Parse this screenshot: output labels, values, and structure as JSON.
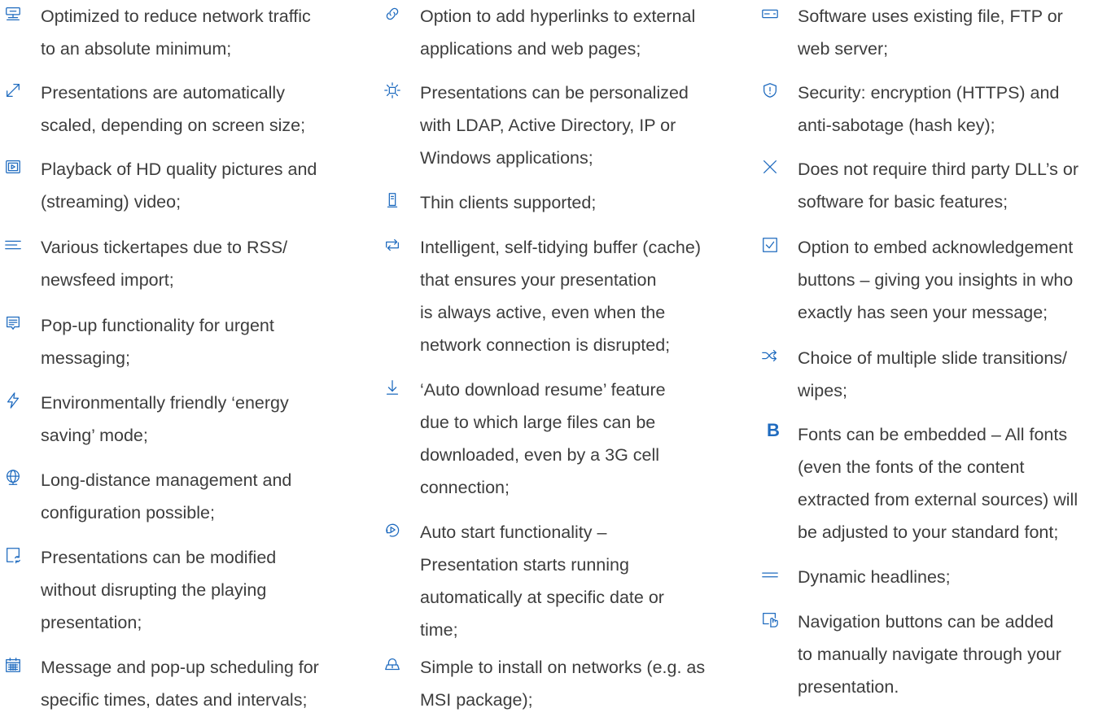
{
  "columns": [
    {
      "items": [
        {
          "icon": "network-monitor-icon",
          "lines": [
            "Optimized to reduce network traffic",
            "to an absolute minimum;"
          ]
        },
        {
          "icon": "expand-arrow-icon",
          "lines": [
            "Presentations are automatically",
            "scaled, depending on screen size;"
          ]
        },
        {
          "icon": "video-screen-icon",
          "lines": [
            "Playback of HD quality pictures and",
            "(streaming) video;"
          ]
        },
        {
          "icon": "text-lines-icon",
          "lines": [
            "Various tickertapes due to RSS/",
            "newsfeed import;"
          ]
        },
        {
          "icon": "message-popup-icon",
          "lines": [
            "Pop-up functionality for urgent",
            "messaging;"
          ]
        },
        {
          "icon": "lightning-icon",
          "lines": [
            "Environmentally friendly ‘energy",
            "saving’ mode;"
          ]
        },
        {
          "icon": "globe-monitor-icon",
          "lines": [
            "Long-distance management and",
            "configuration possible;"
          ]
        },
        {
          "icon": "document-refresh-icon",
          "lines": [
            "Presentations can be modified",
            "without disrupting the playing",
            "presentation;"
          ]
        },
        {
          "icon": "calendar-icon",
          "lines": [
            "Message and pop-up scheduling for",
            "specific times, dates and intervals;"
          ]
        }
      ]
    },
    {
      "items": [
        {
          "icon": "link-icon",
          "lines": [
            "Option to add hyperlinks to external",
            "applications and web pages;"
          ]
        },
        {
          "icon": "personalize-light-icon",
          "lines": [
            "Presentations can be personalized",
            "with LDAP, Active Directory, IP or",
            "Windows applications;"
          ]
        },
        {
          "icon": "thin-client-icon",
          "lines": [
            "Thin clients supported;"
          ]
        },
        {
          "icon": "repeat-icon",
          "lines": [
            "Intelligent, self-tidying buffer (cache)",
            "that ensures your presentation",
            "is always active, even when the",
            "network connection is disrupted;"
          ]
        },
        {
          "icon": "download-arrow-icon",
          "lines": [
            "‘Auto download resume’ feature",
            "due to which large files can be",
            "downloaded, even by a 3G cell",
            "connection;"
          ]
        },
        {
          "icon": "auto-start-icon",
          "lines": [
            "Auto start functionality –",
            "Presentation starts running",
            "automatically at specific date or",
            "time;"
          ]
        },
        {
          "icon": "install-network-icon",
          "lines": [
            "Simple to install on networks (e.g. as",
            "MSI package);"
          ]
        }
      ]
    },
    {
      "items": [
        {
          "icon": "server-icon",
          "lines": [
            "Software uses existing file, FTP or",
            "web server;"
          ]
        },
        {
          "icon": "shield-icon",
          "lines": [
            "Security: encryption (HTTPS) and",
            "anti-sabotage (hash key);"
          ]
        },
        {
          "icon": "close-x-icon",
          "lines": [
            "Does not require third party DLL’s or",
            "software for basic features;"
          ]
        },
        {
          "icon": "checkbox-icon",
          "lines": [
            "Option to embed acknowledgement",
            "buttons – giving you insights in who",
            "exactly has seen your message;"
          ]
        },
        {
          "icon": "shuffle-icon",
          "lines": [
            "Choice of multiple slide transitions/",
            "wipes;"
          ]
        },
        {
          "icon": "bold-b-icon",
          "glyph": "B",
          "lines": [
            "Fonts can be embedded – All fonts",
            "(even the fonts of the content",
            "extracted from external sources) will",
            "be adjusted to your standard font;"
          ]
        },
        {
          "icon": "double-line-icon",
          "lines": [
            "Dynamic headlines;"
          ]
        },
        {
          "icon": "navigation-hand-icon",
          "lines": [
            "Navigation buttons can be added",
            "to manually navigate through your",
            "presentation."
          ]
        }
      ]
    }
  ]
}
